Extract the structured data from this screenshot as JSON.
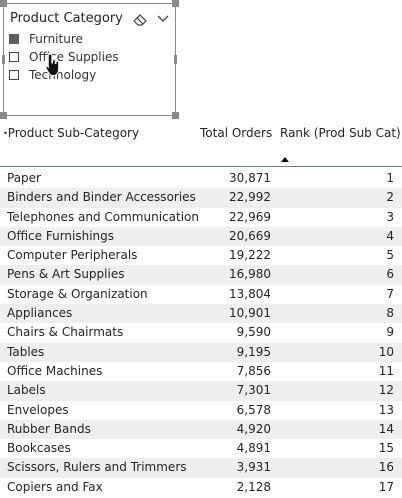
{
  "slicer": {
    "title": "Product Category",
    "eraser_icon": "eraser-icon",
    "chevron_icon": "chevron-down-icon",
    "options": [
      {
        "label": "Furniture",
        "checked": true
      },
      {
        "label": "Office Supplies",
        "checked": false
      },
      {
        "label": "Technology",
        "checked": false
      }
    ],
    "cursor_icon": "hand-pointer-icon"
  },
  "table": {
    "headers": {
      "subcategory": "Product Sub-Category",
      "orders": "Total Orders",
      "rank": "Rank (Prod Sub Cat)"
    },
    "sort_icon": "sort-ascending-icon",
    "rows": [
      {
        "subcategory": "Paper",
        "orders": "30,871",
        "rank": "1"
      },
      {
        "subcategory": "Binders and Binder Accessories",
        "orders": "22,992",
        "rank": "2"
      },
      {
        "subcategory": "Telephones and Communication",
        "orders": "22,969",
        "rank": "3"
      },
      {
        "subcategory": "Office Furnishings",
        "orders": "20,669",
        "rank": "4"
      },
      {
        "subcategory": "Computer Peripherals",
        "orders": "19,222",
        "rank": "5"
      },
      {
        "subcategory": "Pens & Art Supplies",
        "orders": "16,980",
        "rank": "6"
      },
      {
        "subcategory": "Storage & Organization",
        "orders": "13,804",
        "rank": "7"
      },
      {
        "subcategory": "Appliances",
        "orders": "10,901",
        "rank": "8"
      },
      {
        "subcategory": "Chairs & Chairmats",
        "orders": "9,590",
        "rank": "9"
      },
      {
        "subcategory": "Tables",
        "orders": "9,195",
        "rank": "10"
      },
      {
        "subcategory": "Office Machines",
        "orders": "7,856",
        "rank": "11"
      },
      {
        "subcategory": "Labels",
        "orders": "7,301",
        "rank": "12"
      },
      {
        "subcategory": "Envelopes",
        "orders": "6,578",
        "rank": "13"
      },
      {
        "subcategory": "Rubber Bands",
        "orders": "4,920",
        "rank": "14"
      },
      {
        "subcategory": "Bookcases",
        "orders": "4,891",
        "rank": "15"
      },
      {
        "subcategory": "Scissors, Rulers and Trimmers",
        "orders": "3,931",
        "rank": "16"
      },
      {
        "subcategory": "Copiers and Fax",
        "orders": "2,128",
        "rank": "17"
      }
    ]
  },
  "colors": {
    "checked_box": "#5f5f5f",
    "row_shade": "#eeeeee",
    "header_line": "#5a7fa8"
  }
}
